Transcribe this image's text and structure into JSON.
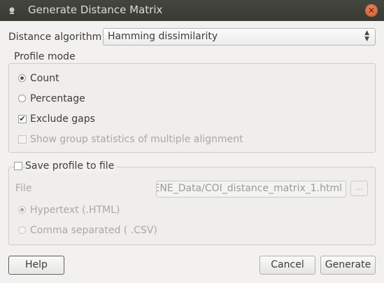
{
  "window": {
    "title": "Generate Distance Matrix",
    "close_glyph": "✕"
  },
  "algorithm": {
    "label": "Distance algorithm",
    "selected": "Hamming dissimilarity"
  },
  "profile_mode": {
    "title": "Profile mode",
    "count_label": "Count",
    "percentage_label": "Percentage",
    "exclude_gaps_label": "Exclude gaps",
    "group_stats_label": "Show group statistics of multiple alignment"
  },
  "save_profile": {
    "title": "Save profile to file",
    "file_label": "File",
    "file_value": "ENE_Data/COI_distance_matrix_1.html",
    "browse_label": "...",
    "hypertext_label": "Hypertext  (.HTML)",
    "csv_label": "Comma separated ( .CSV)"
  },
  "buttons": {
    "help": "Help",
    "cancel": "Cancel",
    "generate": "Generate"
  },
  "icons": {
    "combo_up": "▲",
    "combo_down": "▼",
    "check_mark": "✔"
  },
  "colors": {
    "titlebar": "#3c3b37",
    "close_button": "#e0673a",
    "disabled_text": "#a8a8a8"
  },
  "state": {
    "count_selected": true,
    "percentage_selected": false,
    "exclude_gaps_checked": true,
    "group_stats_checked": false,
    "save_profile_checked": false,
    "hypertext_selected": true,
    "csv_selected": false
  }
}
